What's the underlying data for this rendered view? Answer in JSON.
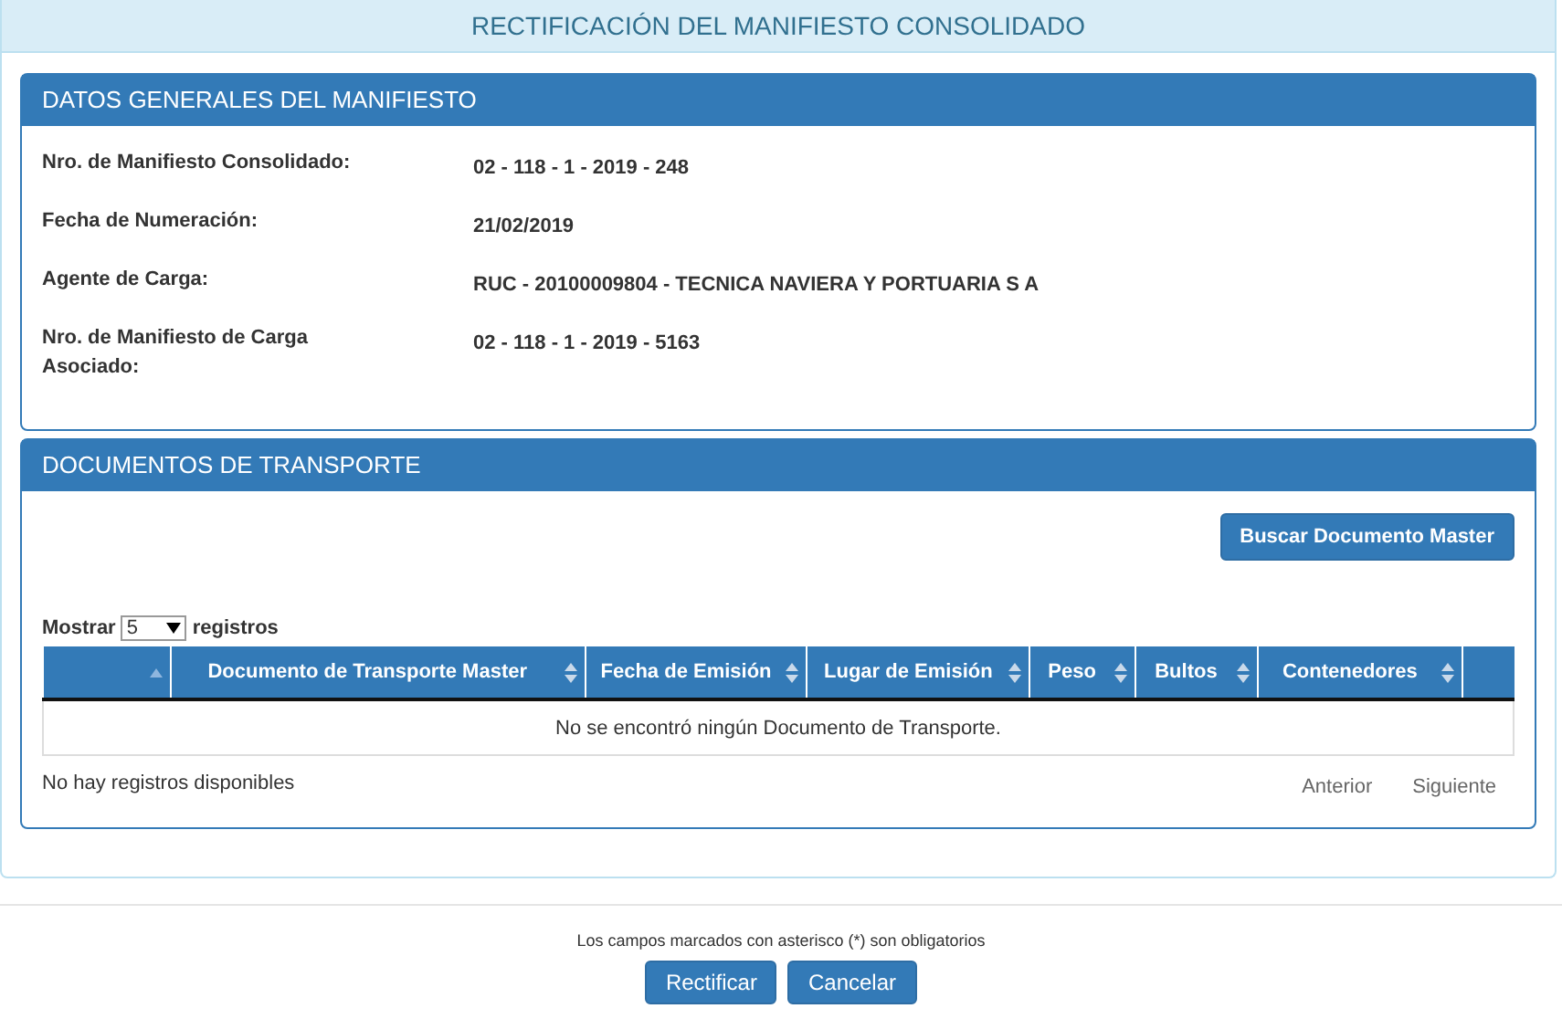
{
  "page_title": "RECTIFICACIÓN DEL MANIFIESTO CONSOLIDADO",
  "general_panel": {
    "title": "DATOS GENERALES DEL MANIFIESTO",
    "fields": [
      {
        "label": "Nro. de Manifiesto Consolidado:",
        "value": "02 - 118 - 1 - 2019 - 248"
      },
      {
        "label": "Fecha de Numeración:",
        "value": "21/02/2019"
      },
      {
        "label": "Agente de Carga:",
        "value": "RUC - 20100009804 - TECNICA NAVIERA Y PORTUARIA S A"
      },
      {
        "label": "Nro. de Manifiesto de Carga Asociado:",
        "value": "02 - 118 - 1 - 2019 - 5163"
      }
    ]
  },
  "documents_panel": {
    "title": "DOCUMENTOS DE TRANSPORTE",
    "search_button": "Buscar Documento Master",
    "length_menu": {
      "before": "Mostrar",
      "value": "5",
      "after": "registros"
    },
    "table": {
      "columns": [
        {
          "kind": "sorted"
        },
        {
          "label": "Documento de Transporte Master",
          "kind": "sortable"
        },
        {
          "label": "Fecha de Emisión",
          "kind": "sortable"
        },
        {
          "label": "Lugar de Emisión",
          "kind": "sortable"
        },
        {
          "label": "Peso",
          "kind": "sortable"
        },
        {
          "label": "Bultos",
          "kind": "sortable"
        },
        {
          "label": "Contenedores",
          "kind": "sortable"
        },
        {
          "kind": "plain"
        }
      ],
      "empty_message": "No se encontró ningún Documento de Transporte."
    },
    "info": "No hay registros disponibles",
    "pagination": [
      "Anterior",
      "Siguiente"
    ]
  },
  "footer_note": "Los campos marcados con asterisco (*) son obligatorios",
  "buttons": [
    "Rectificar",
    "Cancelar"
  ]
}
